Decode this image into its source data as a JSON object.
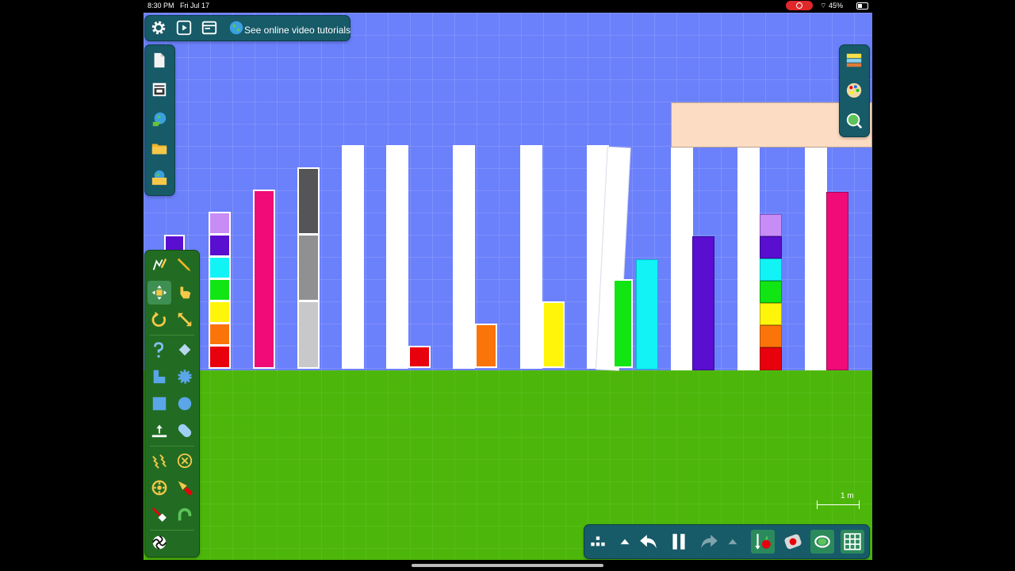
{
  "status_bar": {
    "time": "8:30 PM",
    "date": "Fri Jul 17",
    "battery": "45%"
  },
  "top_toolbar": {
    "tutorial_label": "See online video tutorials"
  },
  "scale": {
    "label": "1 m"
  },
  "icons": {
    "top": [
      "gear-icon",
      "play-icon",
      "window-icon",
      "globe-icon"
    ],
    "left": [
      "new-file-icon",
      "storage-icon",
      "online-browse-icon",
      "folder-icon",
      "online-folder-icon"
    ],
    "right": [
      "layers-icon",
      "palette-icon",
      "zoom-icon"
    ],
    "tools": [
      "sketch-icon",
      "brush-icon",
      "move-icon",
      "drag-icon",
      "rotate-icon",
      "scale-icon",
      "cut-icon",
      "eraser-icon",
      "polygon-icon",
      "gear-shape-icon",
      "box-icon",
      "circle-icon",
      "plane-icon",
      "pin-icon",
      "spring-icon",
      "fixate-icon",
      "hinge-icon",
      "tracer-icon",
      "laser-icon",
      "thruster-icon",
      "chain-icon"
    ],
    "bottom": [
      "grid-dots-icon",
      "caret-up-icon",
      "undo-icon",
      "pause-icon",
      "redo-icon",
      "caret-up-icon",
      "gravity-icon",
      "apple-icon",
      "follow-camera-icon",
      "grid-toggle-icon"
    ]
  },
  "colors": {
    "sky": "#6b80fb",
    "ground": "#4cb70a",
    "white": "#ffffff",
    "lavender": "#c78cf5",
    "violet": "#5a0ecf",
    "cyan": "#12f3f6",
    "green": "#12e514",
    "yellow": "#fff50a",
    "orange": "#fb7409",
    "red": "#e8000c",
    "pink": "#f00b79",
    "dark_gray": "#555558",
    "mid_gray": "#909093",
    "light_gray": "#c8c8cb",
    "peach": "#fcdcc2"
  }
}
